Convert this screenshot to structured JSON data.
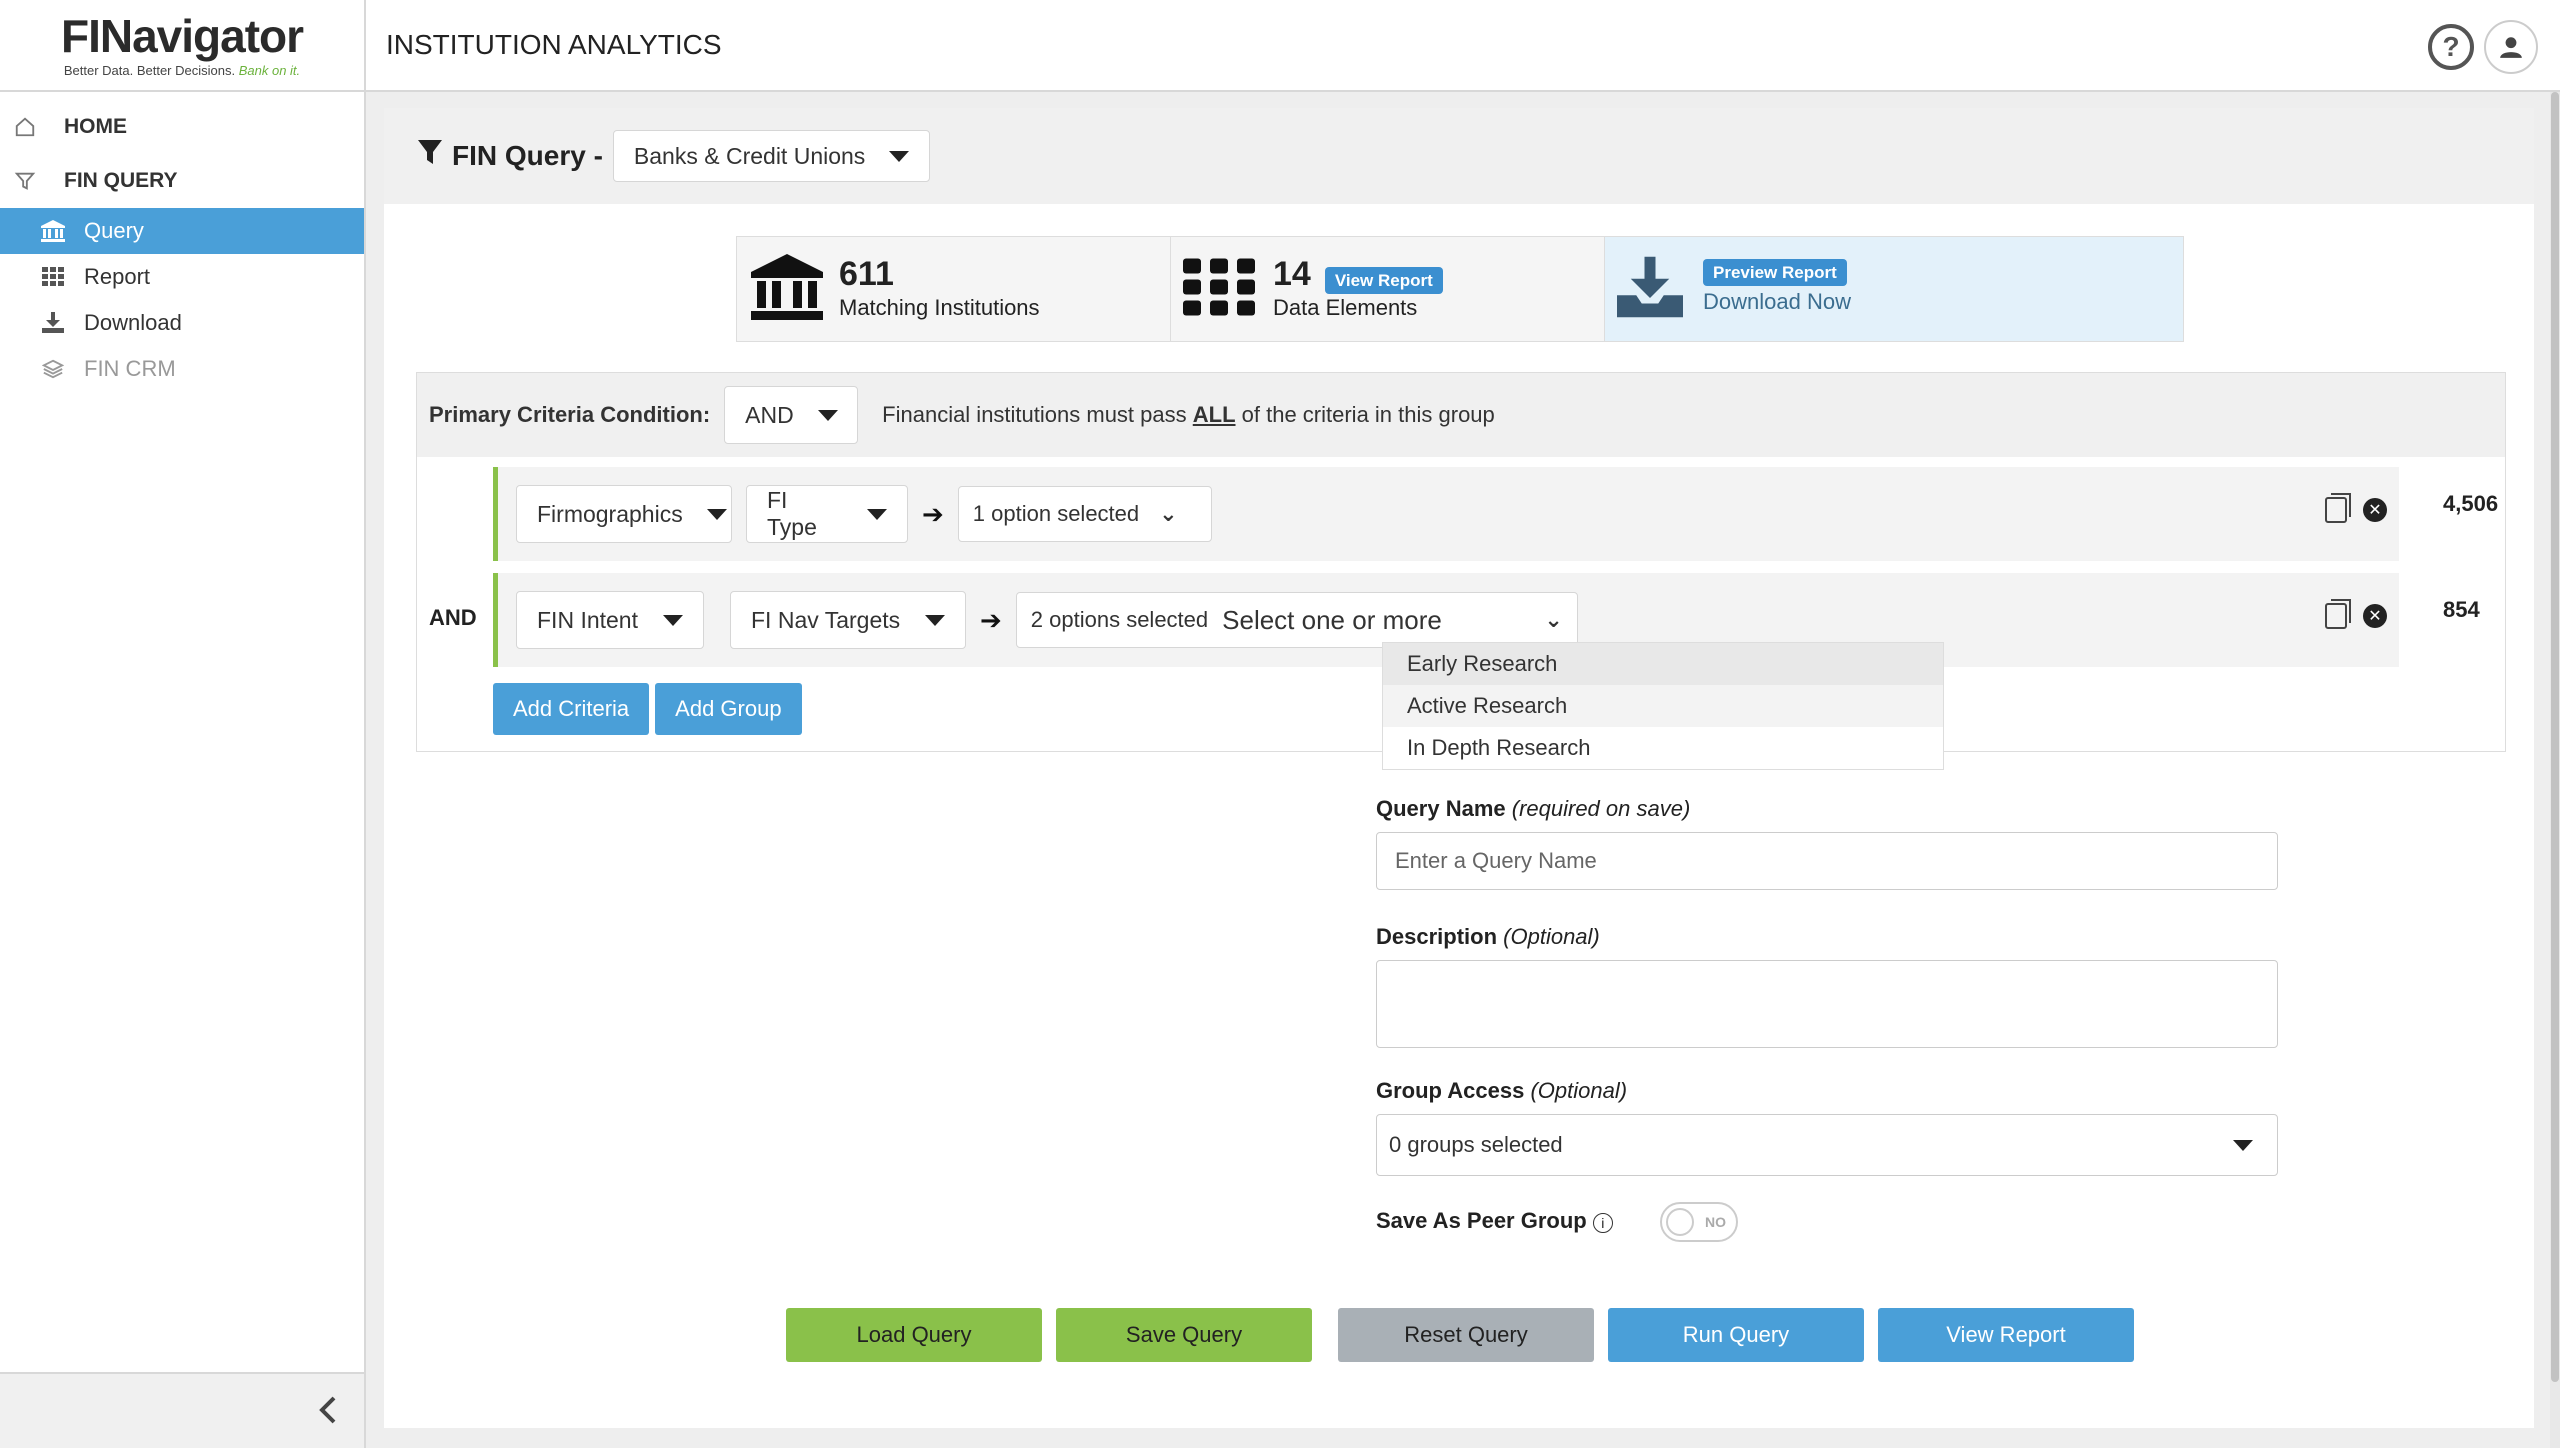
{
  "app": {
    "logo_prefix": "FI",
    "logo_suffix": "Navigator",
    "logo_tagline": "Better Data. Better Decisions.",
    "logo_tagline_accent": "Bank on it.",
    "page_title": "INSTITUTION ANALYTICS"
  },
  "sidebar": {
    "home": "HOME",
    "fin_query": "FIN QUERY",
    "items": [
      {
        "label": "Query",
        "icon": "bank-icon",
        "active": true
      },
      {
        "label": "Report",
        "icon": "grid-icon",
        "active": false
      },
      {
        "label": "Download",
        "icon": "download-icon",
        "active": false
      },
      {
        "label": "FIN CRM",
        "icon": "layers-icon",
        "active": false
      }
    ]
  },
  "query": {
    "title": "FIN Query -",
    "universe": "Banks & Credit Unions"
  },
  "stats": {
    "matching_count": "611",
    "matching_label": "Matching Institutions",
    "elements_count": "14",
    "elements_label": "Data Elements",
    "view_report_badge": "View Report",
    "preview_report_badge": "Preview Report",
    "download_now": "Download Now"
  },
  "criteria": {
    "primary_label": "Primary Criteria Condition:",
    "condition": "AND",
    "description_pre": "Financial institutions must pass",
    "description_em": "ALL",
    "description_post": "of the criteria in this group",
    "rows": [
      {
        "category": "Firmographics",
        "field": "FI Type",
        "value": "1 option selected",
        "count": "4,506"
      },
      {
        "category": "FIN Intent",
        "field": "FI Nav Targets",
        "value": "2 options selected",
        "placeholder": "Select one or more",
        "count": "854"
      }
    ],
    "and_label": "AND",
    "add_criteria": "Add Criteria",
    "add_group": "Add Group",
    "dropdown_options": [
      "Early Research",
      "Active Research",
      "In Depth Research"
    ]
  },
  "form": {
    "query_name_label": "Query Name",
    "query_name_hint": "(required on save)",
    "query_name_placeholder": "Enter a Query Name",
    "description_label": "Description",
    "description_hint": "(Optional)",
    "group_access_label": "Group Access",
    "group_access_hint": "(Optional)",
    "group_access_value": "0 groups selected",
    "peer_group_label": "Save As Peer Group",
    "toggle_text": "NO"
  },
  "actions": {
    "load": "Load Query",
    "save": "Save Query",
    "reset": "Reset Query",
    "run": "Run Query",
    "view": "View Report"
  },
  "colors": {
    "accent_blue": "#4a9fd8",
    "accent_green": "#8ac14a",
    "gray_button": "#a9b0b6"
  }
}
